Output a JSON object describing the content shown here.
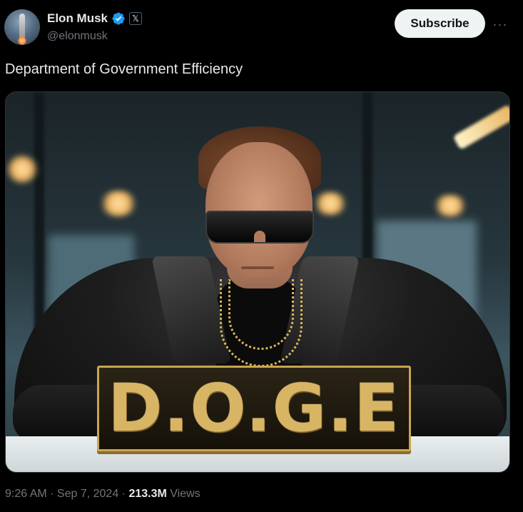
{
  "author": {
    "display_name": "Elon Musk",
    "handle": "@elonmusk",
    "verified_icon": "verified-badge-icon",
    "affiliate_badge": "𝕏"
  },
  "actions": {
    "subscribe_label": "Subscribe",
    "more_icon": "···"
  },
  "post": {
    "text": "Department of Government Efficiency",
    "image_text": "D.O.G.E"
  },
  "meta": {
    "time": "9:26 AM",
    "separator_1": " · ",
    "date": "Sep 7, 2024",
    "separator_2": " · ",
    "views_count": "213.3M",
    "views_label": " Views"
  },
  "colors": {
    "background": "#000000",
    "text_primary": "#e7e9ea",
    "text_secondary": "#71767b",
    "verified_blue": "#1d9bf0",
    "subscribe_bg": "#eff3f4",
    "nameplate_gold": "#d8b565"
  }
}
